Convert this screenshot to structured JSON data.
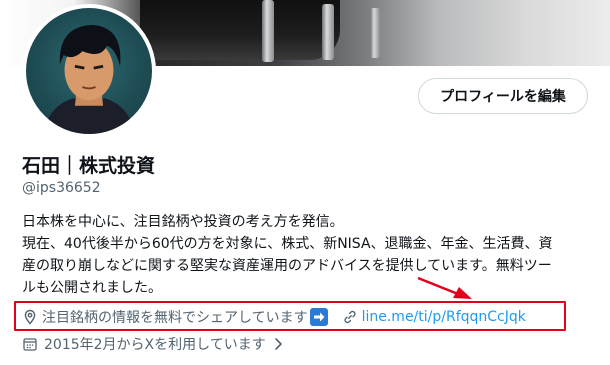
{
  "profile": {
    "edit_button_label": "プロフィールを編集",
    "display_name": "石田｜株式投資",
    "handle": "@ips36652",
    "bio_lines": [
      "日本株を中心に、注目銘柄や投資の考え方を発信。",
      "現在、40代後半から60代の方を対象に、株式、新NISA、退職金、年金、生活費、資",
      "産の取り崩しなどに関する堅実な資産運用のアドバイスを提供しています。無料ツー",
      "ルも公開されました。"
    ],
    "location": "注目銘柄の情報を無料でシェアしています",
    "link": "line.me/ti/p/RfqqnCcJqk",
    "joined": "2015年2月からXを利用しています"
  },
  "icons": {
    "location": "location-pin-icon",
    "arrow_emoji": "right-arrow-emoji-icon",
    "link": "link-icon",
    "calendar": "calendar-icon",
    "chevron": "chevron-right-icon"
  },
  "colors": {
    "link": "#1d9bf0",
    "secondary_text": "#536471",
    "annotation_red": "#e3001b",
    "button_border": "#cfd9de"
  }
}
